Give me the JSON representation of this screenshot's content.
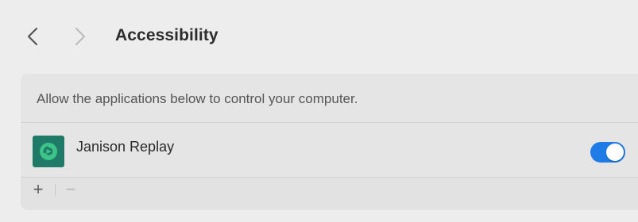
{
  "toolbar": {
    "title": "Accessibility",
    "back_icon": "chevron-left-icon",
    "forward_icon": "chevron-right-icon"
  },
  "panel": {
    "description": "Allow the applications below to control your computer.",
    "apps": [
      {
        "name": "Janison Replay",
        "icon": "janison-replay-app-icon",
        "enabled": true
      }
    ],
    "footer": {
      "add_label": "+",
      "remove_label": "−"
    }
  },
  "colors": {
    "accent": "#1f7ce6",
    "app_icon_bg": "#1f7a68"
  }
}
